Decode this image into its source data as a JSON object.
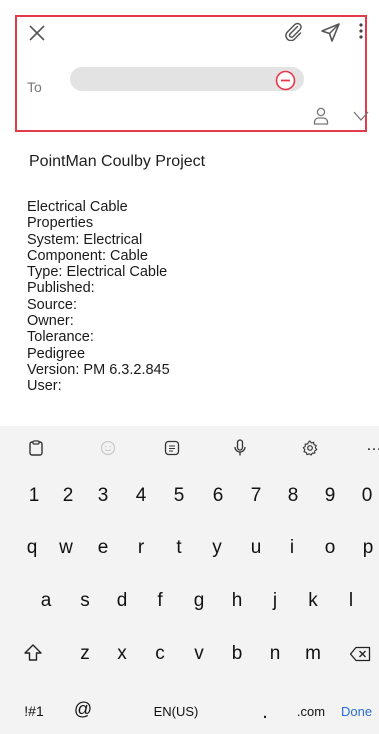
{
  "compose": {
    "to_label": "To",
    "subject": "PointMan Coulby Project",
    "body_lines": [
      "Electrical Cable",
      "Properties",
      "System: Electrical",
      "Component: Cable",
      "Type: Electrical Cable",
      "Published:",
      "Source:",
      "Owner:",
      "Tolerance:",
      "Pedigree",
      "Version: PM 6.3.2.845",
      "User:"
    ]
  },
  "icons": {
    "close": "close-icon",
    "attach": "paperclip-icon",
    "send": "send-icon",
    "more": "more-vertical-icon",
    "remove_recipient": "minus-circle-icon",
    "contacts": "person-icon",
    "expand": "chevron-down-icon"
  },
  "keyboard": {
    "toolbar_more": "…",
    "number_row": [
      "1",
      "2",
      "3",
      "4",
      "5",
      "6",
      "7",
      "8",
      "9",
      "0"
    ],
    "row1": [
      "q",
      "w",
      "e",
      "r",
      "t",
      "y",
      "u",
      "i",
      "o",
      "p"
    ],
    "row2": [
      "a",
      "s",
      "d",
      "f",
      "g",
      "h",
      "j",
      "k",
      "l"
    ],
    "row3": [
      "z",
      "x",
      "c",
      "v",
      "b",
      "n",
      "m"
    ],
    "symbols_key": "!#1",
    "at_key": "@",
    "space_label": "EN(US)",
    "dot_key": ".",
    "com_key": ".com",
    "done_key": "Done"
  },
  "colors": {
    "highlight_border": "#e23b4a",
    "remove_icon": "#e8394a",
    "done_key": "#2a6bd6"
  }
}
